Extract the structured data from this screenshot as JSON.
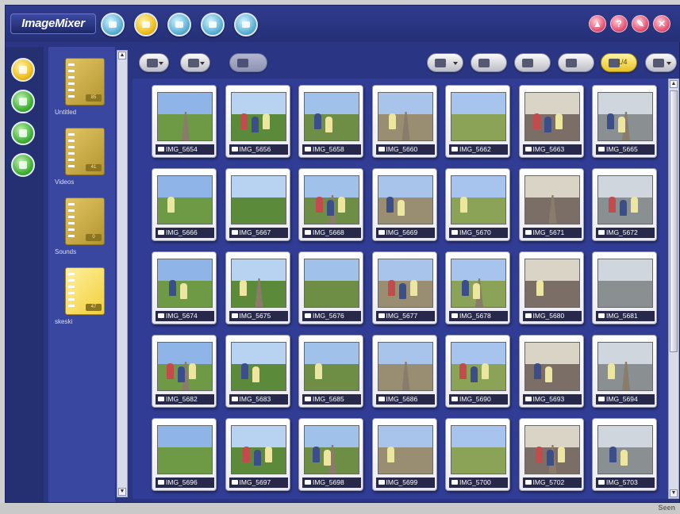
{
  "app": {
    "title": "ImageMixer"
  },
  "titlebar": {
    "modes": [
      {
        "name": "mode-1-icon",
        "color": "cyan"
      },
      {
        "name": "mode-album-icon",
        "color": "gold",
        "active": true
      },
      {
        "name": "mode-3-icon",
        "color": "cyan"
      },
      {
        "name": "mode-4-icon",
        "color": "cyan"
      },
      {
        "name": "mode-5-icon",
        "color": "cyan"
      }
    ],
    "system_buttons": [
      {
        "name": "print-icon",
        "glyph": "▲"
      },
      {
        "name": "help-icon",
        "glyph": "?"
      },
      {
        "name": "tools-icon",
        "glyph": "✎"
      },
      {
        "name": "close-icon",
        "glyph": "✕"
      }
    ]
  },
  "sidebar": {
    "buttons": [
      {
        "name": "album-mode-button",
        "color": "gold"
      },
      {
        "name": "import-button",
        "color": "green"
      },
      {
        "name": "export-button",
        "color": "green"
      },
      {
        "name": "search-button",
        "color": "green"
      }
    ]
  },
  "albums": [
    {
      "name": "Untitled",
      "tag": "85"
    },
    {
      "name": "Videos",
      "tag": "41"
    },
    {
      "name": "Sounds",
      "tag": "0"
    },
    {
      "name": "skeski",
      "tag": "47",
      "active": true
    }
  ],
  "toolbar": {
    "left_buttons": [
      "new-album-icon",
      "copy-icon",
      "text-icon"
    ],
    "right_buttons": [
      "video-capture-icon",
      "slideshow-icon",
      "display-icon",
      "sort-icon",
      "view-toggle-icon",
      "lock-icon"
    ],
    "view_label": "1/4"
  },
  "thumbnails": [
    "IMG_5654",
    "IMG_5656",
    "IMG_5658",
    "IMG_5660",
    "IMG_5662",
    "IMG_5663",
    "IMG_5665",
    "IMG_5666",
    "IMG_5667",
    "IMG_5668",
    "IMG_5669",
    "IMG_5670",
    "IMG_5671",
    "IMG_5672",
    "IMG_5674",
    "IMG_5675",
    "IMG_5676",
    "IMG_5677",
    "IMG_5678",
    "IMG_5680",
    "IMG_5681",
    "IMG_5682",
    "IMG_5683",
    "IMG_5685",
    "IMG_5686",
    "IMG_5690",
    "IMG_5693",
    "IMG_5694",
    "IMG_5696",
    "IMG_5697",
    "IMG_5698",
    "IMG_5699",
    "IMG_5700",
    "IMG_5702",
    "IMG_5703"
  ],
  "statusbar": {
    "right_text": "Seen"
  },
  "colors": {
    "background": "#2a3683",
    "panel": "#313d94",
    "album_gold": "#e2c564",
    "caption_bg": "#27284a"
  }
}
